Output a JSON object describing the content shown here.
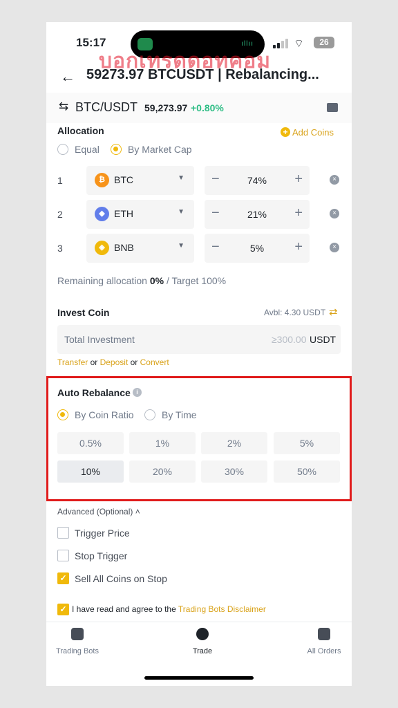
{
  "status": {
    "time": "15:17",
    "battery": "26"
  },
  "watermark": "บอกเทรดดอทคอม",
  "header": {
    "back_icon": "arrow-left-icon",
    "title": "59273.97 BTCUSDT | Rebalancing..."
  },
  "pair": {
    "name": "BTC/USDT",
    "price": "59,273.97",
    "change": "+0.80%",
    "change_color": "#2ebd85"
  },
  "allocation": {
    "label": "Allocation",
    "add_coins": "Add Coins",
    "modes": [
      "Equal",
      "By Market Cap"
    ],
    "selected_mode": "By Market Cap",
    "rows": [
      {
        "num": "1",
        "coin": "BTC",
        "pct": "74%",
        "color": "#f7931a",
        "glyph": "₿"
      },
      {
        "num": "2",
        "coin": "ETH",
        "pct": "21%",
        "color": "#627eea",
        "glyph": "◆"
      },
      {
        "num": "3",
        "coin": "BNB",
        "pct": "5%",
        "color": "#f0b90b",
        "glyph": "◈"
      }
    ],
    "remaining_label": "Remaining allocation",
    "remaining_value": "0%",
    "target": "/ Target 100%"
  },
  "invest": {
    "label": "Invest Coin",
    "avbl": "Avbl: 4.30 USDT",
    "placeholder": "Total Investment",
    "min": "≥300.00",
    "currency": "USDT",
    "links": {
      "transfer": "Transfer",
      "or1": "or",
      "deposit": "Deposit",
      "or2": "or",
      "convert": "Convert"
    }
  },
  "auto_rebalance": {
    "label": "Auto Rebalance",
    "modes": [
      "By Coin Ratio",
      "By Time"
    ],
    "selected_mode": "By Coin Ratio",
    "options": [
      "0.5%",
      "1%",
      "2%",
      "5%",
      "10%",
      "20%",
      "30%",
      "50%"
    ],
    "selected_option": "10%"
  },
  "advanced": {
    "label": "Advanced (Optional)",
    "items": [
      {
        "label": "Trigger Price",
        "checked": false
      },
      {
        "label": "Stop Trigger",
        "checked": false
      },
      {
        "label": "Sell All Coins on Stop",
        "checked": true
      }
    ]
  },
  "disclaimer": {
    "text": "I have read and agree to the",
    "link": "Trading Bots Disclaimer",
    "checked": true
  },
  "tabs": [
    {
      "label": "Trading Bots",
      "icon": "robot-icon"
    },
    {
      "label": "Trade",
      "icon": "trade-icon"
    },
    {
      "label": "All Orders",
      "icon": "orders-icon"
    }
  ],
  "colors": {
    "accent": "#f0b90b",
    "highlight_frame": "#e01b1b"
  }
}
